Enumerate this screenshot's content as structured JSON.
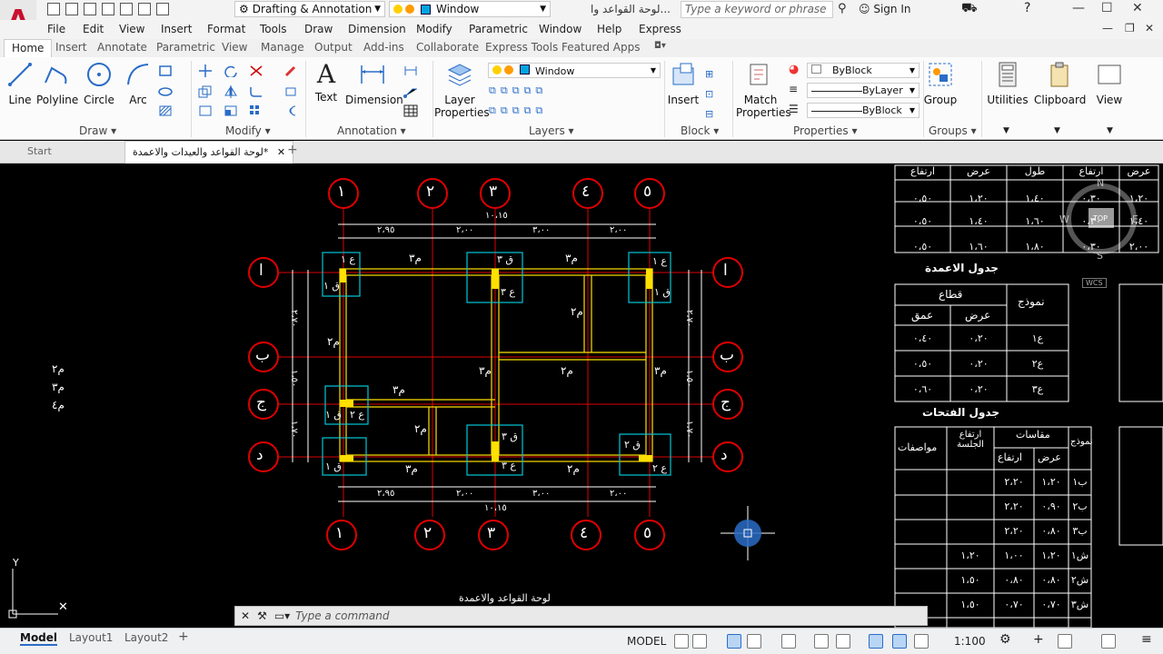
{
  "app": {
    "logo_letter": "A",
    "workspace": "Drafting & Annotation",
    "layer_current": "Window",
    "title": "لوحة القواعد وا...",
    "search_placeholder": "Type a keyword or phrase",
    "sign_in": "Sign In"
  },
  "menus": [
    "File",
    "Edit",
    "View",
    "Insert",
    "Format",
    "Tools",
    "Draw",
    "Dimension",
    "Modify",
    "Parametric",
    "Window",
    "Help",
    "Express"
  ],
  "ribbon_tabs": [
    "Home",
    "Insert",
    "Annotate",
    "Parametric",
    "View",
    "Manage",
    "Output",
    "Add-ins",
    "Collaborate",
    "Express Tools",
    "Featured Apps"
  ],
  "ribbon": {
    "draw": {
      "line": "Line",
      "polyline": "Polyline",
      "circle": "Circle",
      "arc": "Arc",
      "panel": "Draw"
    },
    "modify": {
      "panel": "Modify"
    },
    "annotation": {
      "text": "Text",
      "dimension": "Dimension",
      "panel": "Annotation"
    },
    "layers": {
      "layer_properties": "Layer Properties",
      "current": "Window",
      "panel": "Layers"
    },
    "block": {
      "insert": "Insert",
      "panel": "Block"
    },
    "properties": {
      "match": "Match Properties",
      "color": "ByBlock",
      "linetype": "ByLayer",
      "lineweight": "ByBlock",
      "panel": "Properties"
    },
    "groups": {
      "group": "Group",
      "panel": "Groups"
    },
    "utilities": "Utilities",
    "clipboard": "Clipboard",
    "view": "View"
  },
  "file_tabs": {
    "start": "Start",
    "active": "لوحة القواعد والعيدات والاعمدة*"
  },
  "drawing": {
    "grid_top_labels": [
      "١",
      "٢",
      "٣",
      "٤",
      "٥"
    ],
    "grid_side_labels": [
      "ا",
      "ب",
      "ج",
      "د"
    ],
    "top_dims": [
      "٢،٩٥",
      "٢،٠٠",
      "٣،٠٠",
      "٢،٠٠"
    ],
    "total_dim": "١٠،١٥",
    "bottom_dims": [
      "٢،٩٥",
      "٢،٠٠",
      "٣،٠٠",
      "٢،٠٠"
    ],
    "side_dims": [
      "٢،٧٠",
      "١،٥٠",
      "١،٧٠"
    ],
    "plan_title": "لوحة القواعد والاعمدة",
    "footing_labels": [
      "ق ١",
      "ع ١",
      "ق ٣",
      "ع ٣",
      "ع ٢",
      "ق ٢"
    ],
    "beam_label": "م",
    "left_annotation": [
      "م٢",
      "م٣",
      "م٤"
    ],
    "compass": {
      "n": "N",
      "s": "S",
      "e": "E",
      "w": "W",
      "top": "TOP",
      "wcs": "WCS"
    }
  },
  "tables": {
    "top_table": {
      "headers": [
        "ارتفاع",
        "عرض",
        "طول",
        "ارتفاع",
        "عرض"
      ],
      "rows": [
        [
          "٠،٥٠",
          "١،٢٠",
          "١،٤٠",
          "٠،٣٠",
          "١،٢٠"
        ],
        [
          "٠،٥٠",
          "١،٤٠",
          "١،٦٠",
          "٠،٣٠",
          "١،٤٠"
        ],
        [
          "٠،٥٠",
          "١،٦٠",
          "١،٨٠",
          "٠،٣٠",
          "٢،٠٠"
        ]
      ]
    },
    "columns_table": {
      "title": "جدول الاعمدة",
      "section": "قطاع",
      "model": "نموذج",
      "depth": "عمق",
      "width": "عرض",
      "rows": [
        [
          "٠،٤٠",
          "٠،٢٠",
          "ع١"
        ],
        [
          "٠،٥٠",
          "٠،٢٠",
          "ع٢"
        ],
        [
          "٠،٦٠",
          "٠،٢٠",
          "ع٣"
        ]
      ]
    },
    "openings_table": {
      "title": "جدول الفتحات",
      "spec": "مواصفات",
      "sill": "ارتفاع الجلسة",
      "dims": "مقاسات",
      "height": "ارتفاع",
      "width": "عرض",
      "model": "نموذج",
      "rows": [
        [
          "",
          "",
          "٢،٢٠",
          "١،٢٠",
          "ب١"
        ],
        [
          "",
          "",
          "٢،٢٠",
          "٠،٩٠",
          "ب٢"
        ],
        [
          "",
          "",
          "٢،٢٠",
          "٠،٨٠",
          "ب٣"
        ],
        [
          "",
          "١،٢٠",
          "١،٠٠",
          "١،٢٠",
          "ش١"
        ],
        [
          "",
          "١،٥٠",
          "٠،٨٠",
          "٠،٨٠",
          "ش٢"
        ],
        [
          "",
          "١،٥٠",
          "٠،٧٠",
          "٠،٧٠",
          "ش٣"
        ]
      ]
    }
  },
  "command": {
    "placeholder": "Type a command"
  },
  "status": {
    "model_tab": "Model",
    "layout1": "Layout1",
    "layout2": "Layout2",
    "model_space": "MODEL",
    "scale": "1:100"
  }
}
